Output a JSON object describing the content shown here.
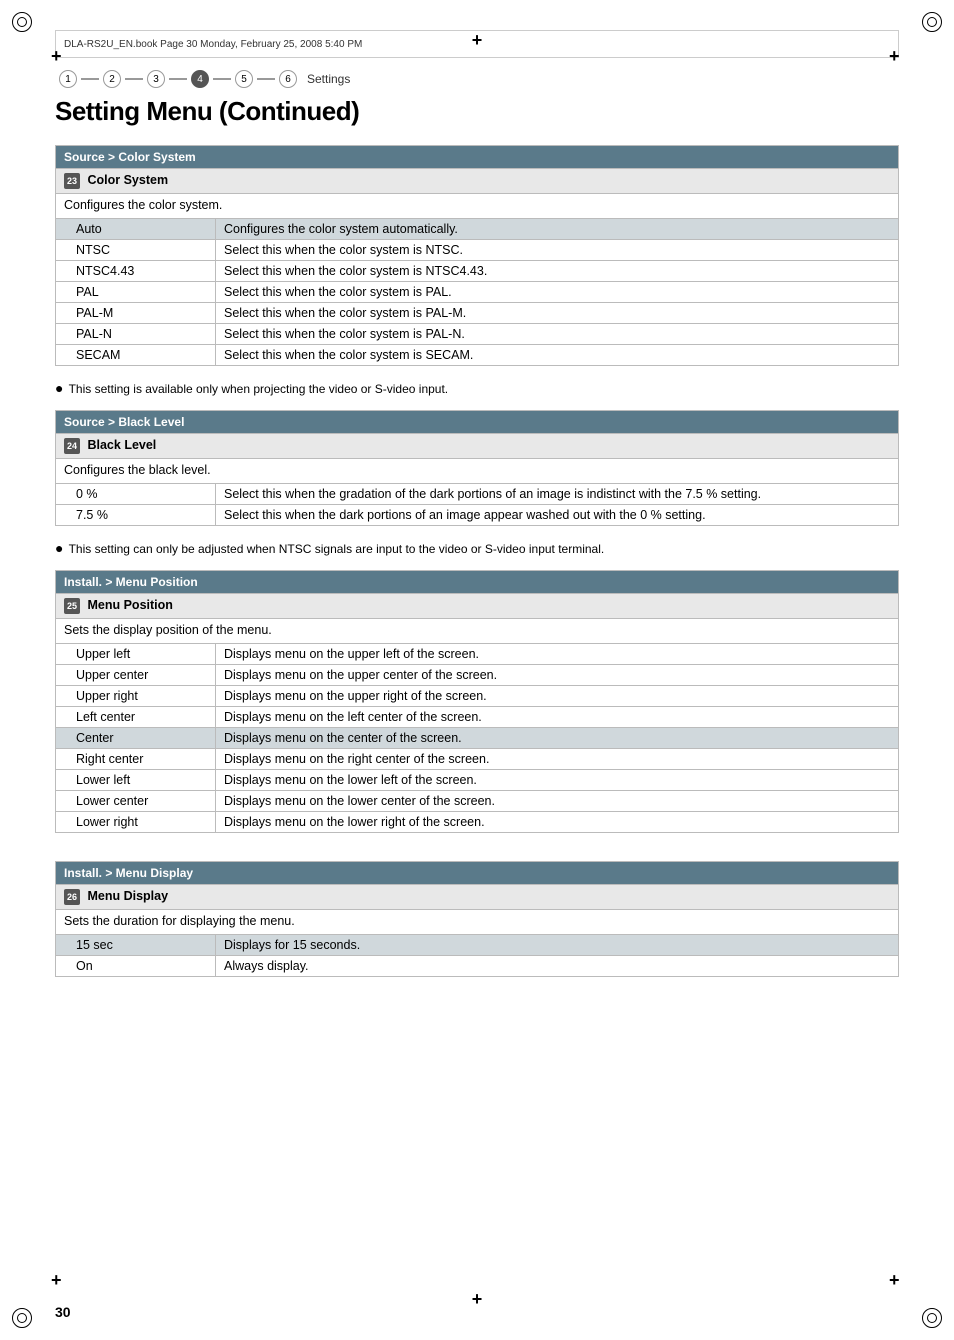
{
  "page": {
    "title": "Setting Menu (Continued)",
    "number": "30",
    "header_text": "DLA-RS2U_EN.book  Page 30  Monday, February 25, 2008  5:40 PM"
  },
  "step_indicator": {
    "steps": [
      "1",
      "2",
      "3",
      "4",
      "5",
      "6"
    ],
    "active_step": 3,
    "label": "Settings"
  },
  "sections": [
    {
      "id": "color_system",
      "header": "Source > Color System",
      "subsection_number": "23",
      "subsection_label": "Color System",
      "description": "Configures the color system.",
      "rows": [
        {
          "option": "Auto",
          "desc": "Configures the color system automatically.",
          "highlighted": true
        },
        {
          "option": "NTSC",
          "desc": "Select this when the color system is NTSC.",
          "highlighted": false
        },
        {
          "option": "NTSC4.43",
          "desc": "Select this when the color system is NTSC4.43.",
          "highlighted": false
        },
        {
          "option": "PAL",
          "desc": "Select this when the color system is PAL.",
          "highlighted": false
        },
        {
          "option": "PAL-M",
          "desc": "Select this when the color system is PAL-M.",
          "highlighted": false
        },
        {
          "option": "PAL-N",
          "desc": "Select this when the color system is PAL-N.",
          "highlighted": false
        },
        {
          "option": "SECAM",
          "desc": "Select this when the color system is SECAM.",
          "highlighted": false
        }
      ],
      "note": "This setting is available only when projecting the video or S-video input."
    },
    {
      "id": "black_level",
      "header": "Source > Black Level",
      "subsection_number": "24",
      "subsection_label": "Black Level",
      "description": "Configures the black level.",
      "rows": [
        {
          "option": "0 %",
          "desc": "Select this when the gradation of the dark portions of an image is indistinct with the 7.5 % setting.",
          "highlighted": false
        },
        {
          "option": "7.5 %",
          "desc": "Select this when the dark portions of an image appear washed out with the 0 % setting.",
          "highlighted": false
        }
      ],
      "note": "This setting can only be adjusted when NTSC signals are input to the video or S-video input terminal."
    },
    {
      "id": "menu_position",
      "header": "Install. > Menu Position",
      "subsection_number": "25",
      "subsection_label": "Menu Position",
      "description": "Sets the display position of the menu.",
      "rows": [
        {
          "option": "Upper left",
          "desc": "Displays menu on the upper left of the screen.",
          "highlighted": false
        },
        {
          "option": "Upper center",
          "desc": "Displays menu on the upper center of the screen.",
          "highlighted": false
        },
        {
          "option": "Upper right",
          "desc": "Displays menu on the upper right of the screen.",
          "highlighted": false
        },
        {
          "option": "Left center",
          "desc": "Displays menu on the left center of the screen.",
          "highlighted": false
        },
        {
          "option": "Center",
          "desc": "Displays menu on the center of the screen.",
          "highlighted": true
        },
        {
          "option": "Right center",
          "desc": "Displays menu on the right center of the screen.",
          "highlighted": false
        },
        {
          "option": "Lower left",
          "desc": "Displays menu on the lower left of the screen.",
          "highlighted": false
        },
        {
          "option": "Lower center",
          "desc": "Displays menu on the lower center of the screen.",
          "highlighted": false
        },
        {
          "option": "Lower right",
          "desc": "Displays menu on the lower right of the screen.",
          "highlighted": false
        }
      ],
      "note": null
    },
    {
      "id": "menu_display",
      "header": "Install. > Menu Display",
      "subsection_number": "26",
      "subsection_label": "Menu Display",
      "description": "Sets the duration for displaying the menu.",
      "rows": [
        {
          "option": "15 sec",
          "desc": "Displays for 15 seconds.",
          "highlighted": true
        },
        {
          "option": "On",
          "desc": "Always display.",
          "highlighted": false
        }
      ],
      "note": null
    }
  ]
}
